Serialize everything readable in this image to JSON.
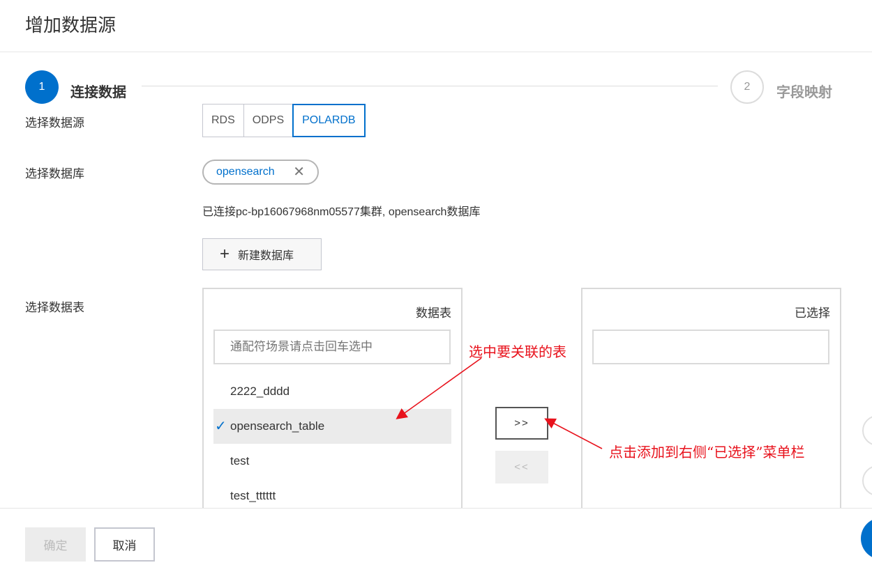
{
  "title": "增加数据源",
  "steps": [
    {
      "number": "1",
      "label": "连接数据"
    },
    {
      "number": "2",
      "label": "字段映射"
    }
  ],
  "form": {
    "datasource_label": "选择数据源",
    "datasource_options": [
      "RDS",
      "ODPS",
      "POLARDB"
    ],
    "datasource_selected": "POLARDB",
    "database_label": "选择数据库",
    "database_tag": "opensearch",
    "connection_info": "已连接pc-bp16067968nm05577集群, opensearch数据库",
    "new_database_label": "新建数据库",
    "table_label": "选择数据表"
  },
  "transfer": {
    "left_title": "数据表",
    "left_search_placeholder": "通配符场景请点击回车选中",
    "items": [
      {
        "name": "2222_dddd",
        "checked": false
      },
      {
        "name": "opensearch_table",
        "checked": true
      },
      {
        "name": "test",
        "checked": false
      },
      {
        "name": "test_tttttt",
        "checked": false
      }
    ],
    "right_title": "已选择",
    "right_search_placeholder": "",
    "add_button": ">>",
    "remove_button": "<<"
  },
  "annotations": {
    "select_table": "选中要关联的表",
    "click_add": "点击添加到右侧“已选择”菜单栏",
    "color": "#e8121c"
  },
  "footer": {
    "ok_label": "确定",
    "cancel_label": "取消"
  },
  "colors": {
    "primary": "#0070cc",
    "annotation": "#e8121c"
  }
}
